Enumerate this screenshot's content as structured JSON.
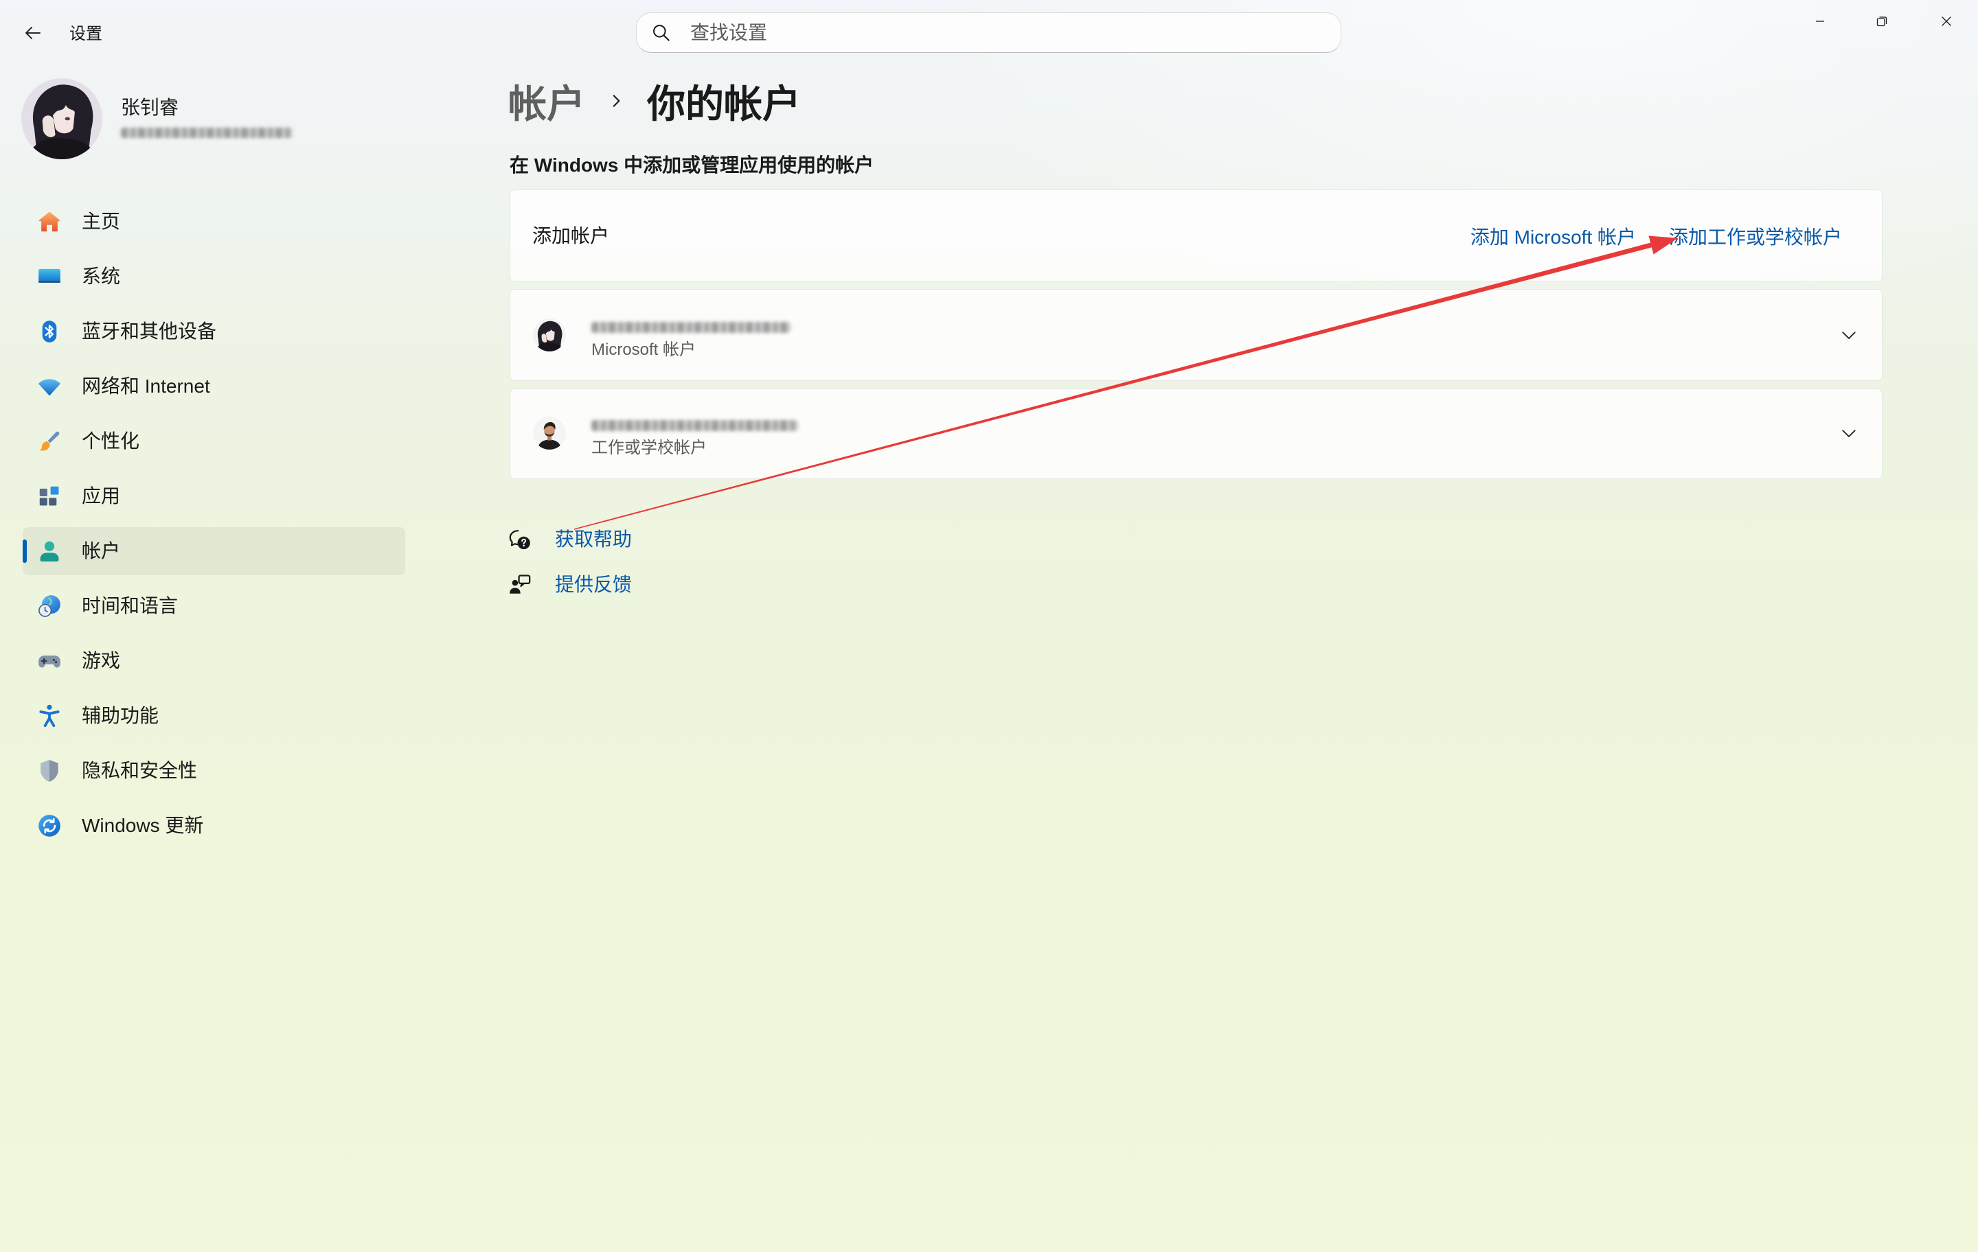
{
  "window": {
    "title": "设置",
    "controls": {
      "minimize_icon": "minimize-icon",
      "restore_icon": "restore-icon",
      "close_icon": "close-icon"
    }
  },
  "search": {
    "placeholder": "查找设置",
    "icon": "search-icon"
  },
  "user": {
    "name": "张钊睿",
    "avatar": "user-avatar"
  },
  "nav": {
    "items": [
      {
        "label": "主页",
        "icon": "home-icon"
      },
      {
        "label": "系统",
        "icon": "system-icon"
      },
      {
        "label": "蓝牙和其他设备",
        "icon": "bluetooth-icon"
      },
      {
        "label": "网络和 Internet",
        "icon": "wifi-icon"
      },
      {
        "label": "个性化",
        "icon": "brush-icon"
      },
      {
        "label": "应用",
        "icon": "apps-icon"
      },
      {
        "label": "帐户",
        "icon": "person-icon",
        "selected": true
      },
      {
        "label": "时间和语言",
        "icon": "globe-clock-icon"
      },
      {
        "label": "游戏",
        "icon": "gamepad-icon"
      },
      {
        "label": "辅助功能",
        "icon": "accessibility-icon"
      },
      {
        "label": "隐私和安全性",
        "icon": "shield-icon"
      },
      {
        "label": "Windows 更新",
        "icon": "update-icon"
      }
    ]
  },
  "breadcrumb": {
    "parent": "帐户",
    "current": "你的帐户"
  },
  "page": {
    "description": "在 Windows 中添加或管理应用使用的帐户"
  },
  "add_account": {
    "label": "添加帐户",
    "microsoft_link": "添加 Microsoft 帐户",
    "work_link": "添加工作或学校帐户"
  },
  "accounts": [
    {
      "type_label": "Microsoft 帐户",
      "expanded": false
    },
    {
      "type_label": "工作或学校帐户",
      "expanded": false
    }
  ],
  "links": {
    "help": "获取帮助",
    "feedback": "提供反馈"
  },
  "colors": {
    "accent": "#005fb8",
    "link": "#0a59a8",
    "annotation_arrow": "#e83a3a"
  }
}
